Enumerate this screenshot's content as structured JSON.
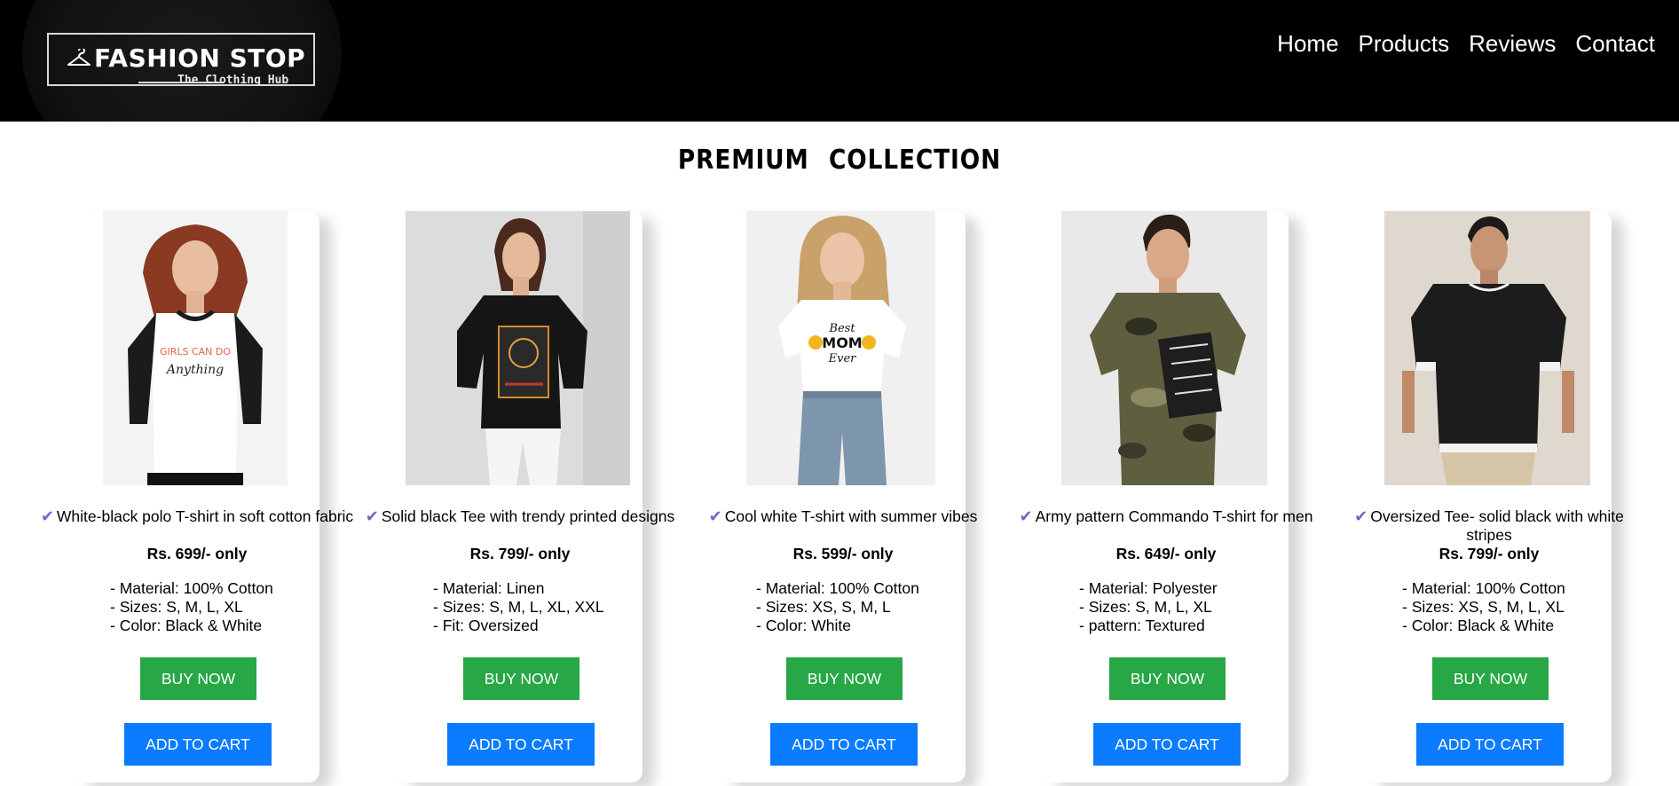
{
  "brand": {
    "title": "FASHION STOP",
    "tagline": "The Clothing Hub"
  },
  "nav": {
    "items": [
      "Home",
      "Products",
      "Reviews",
      "Contact"
    ]
  },
  "section": {
    "title": "PREMIUM COLLECTION"
  },
  "products": [
    {
      "title": "White-black polo T-shirt in soft cotton fabric",
      "price": "Rs. 699/- only",
      "specs": [
        "- Material: 100% Cotton",
        "- Sizes: S, M, L, XL",
        "- Color: Black & White"
      ],
      "buy_label": "BUY NOW",
      "cart_label": "ADD TO CART",
      "print_text": [
        "GIRLS CAN DO",
        "Anything"
      ]
    },
    {
      "title": "Solid black Tee with trendy printed designs",
      "price": "Rs. 799/- only",
      "specs": [
        "- Material: Linen",
        "- Sizes: S, M, L, XL, XXL",
        "- Fit: Oversized"
      ],
      "buy_label": "BUY NOW",
      "cart_label": "ADD TO CART"
    },
    {
      "title": "Cool white T-shirt with summer vibes",
      "price": "Rs. 599/- only",
      "specs": [
        "- Material: 100% Cotton",
        "- Sizes: XS, S, M, L",
        "- Color: White"
      ],
      "buy_label": "BUY NOW",
      "cart_label": "ADD TO CART",
      "print_text": [
        "Best",
        "MOM",
        "Ever"
      ]
    },
    {
      "title": "Army pattern Commando T-shirt for men",
      "price": "Rs. 649/- only",
      "specs": [
        "- Material: Polyester",
        "- Sizes: S, M, L, XL",
        "- pattern: Textured"
      ],
      "buy_label": "BUY NOW",
      "cart_label": "ADD TO CART"
    },
    {
      "title": "Oversized Tee- solid black with white stripes",
      "price": "Rs. 799/- only",
      "specs": [
        "- Material: 100% Cotton",
        "- Sizes: XS, S, M, L, XL",
        "- Color: Black & White"
      ],
      "buy_label": "BUY NOW",
      "cart_label": "ADD TO CART"
    }
  ],
  "colors": {
    "navbar": "#000000",
    "buy_button": "#27a745",
    "cart_button": "#0b7bff",
    "checkmark": "#7a64c8"
  },
  "icons": {
    "check": "✔",
    "logo": "hanger-icon"
  }
}
